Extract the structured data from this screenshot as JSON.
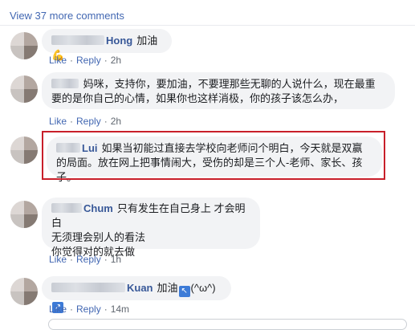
{
  "view_more": "View 37 more comments",
  "actions": {
    "like": "Like",
    "reply": "Reply",
    "sep": "·"
  },
  "comments": [
    {
      "name": "Hong",
      "text": "加油",
      "emoji": "💪",
      "time": "2h"
    },
    {
      "name": "",
      "text": "妈咪，支持你，要加油，不要理那些无聊的人说什么，现在最重要的是你自己的心情，如果你也这样消极，你的孩子该怎么办，",
      "time": "2h"
    },
    {
      "name": "Lui",
      "text": "如果当初能过直接去学校向老师问个明白，今天就是双赢的局面。放在网上把事情闹大，受伤的却是三个人-老师、家长、孩子。",
      "time": ""
    },
    {
      "name": "Chum",
      "text_lines": [
        "只有发生在自己身上 才会明白",
        "无须理会别人的看法",
        "你觉得对的就去做"
      ],
      "time": "1h"
    },
    {
      "name": "Kuan",
      "text": "加油",
      "emoji_left": "↖",
      "kaomoji": "(^ω^)",
      "emoji_right": "↗",
      "time": "14m"
    }
  ]
}
